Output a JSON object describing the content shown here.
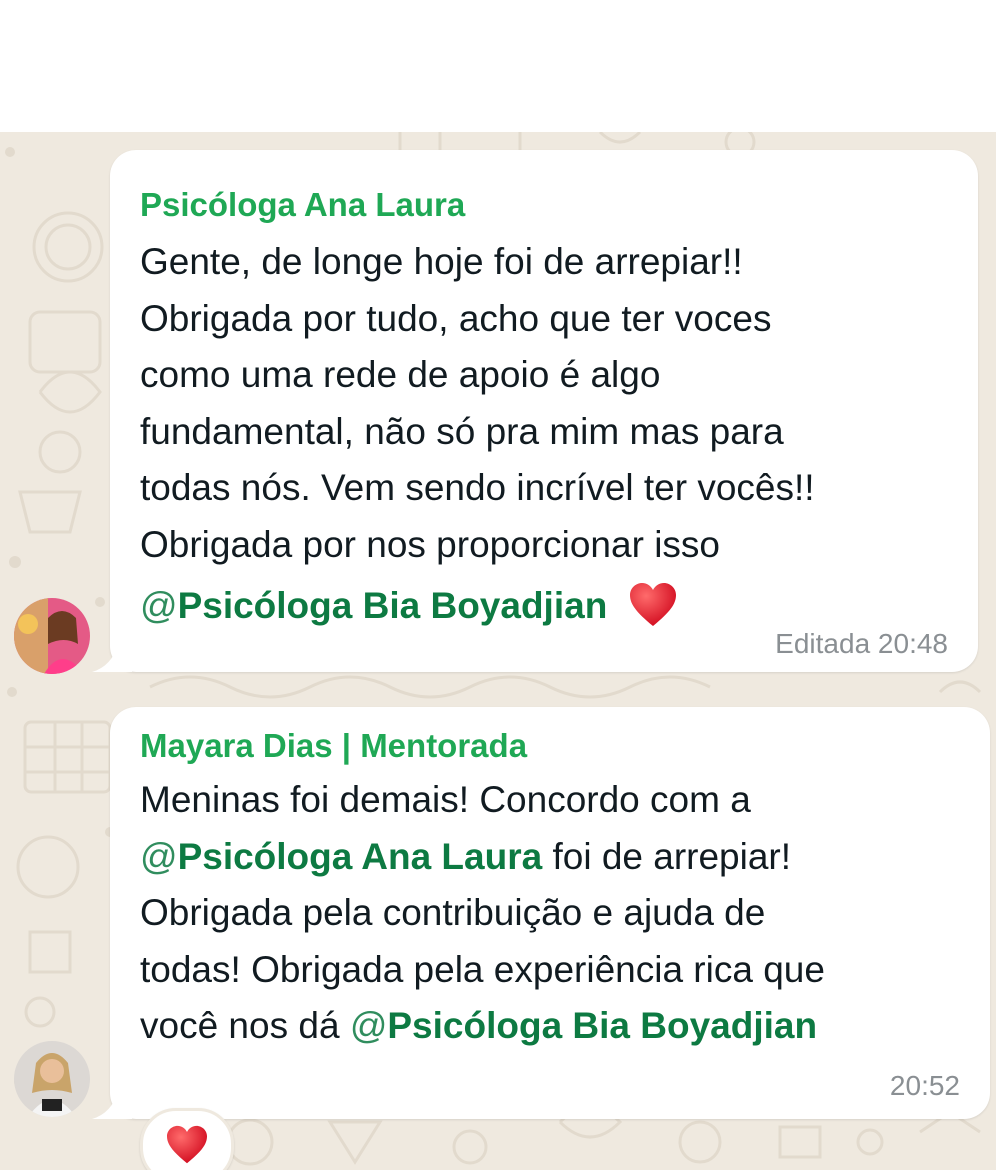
{
  "chat": {
    "messages": [
      {
        "sender": "Psicóloga Ana Laura",
        "lines": [
          "Gente, de longe hoje foi de arrepiar!!",
          "Obrigada por tudo, acho que ter voces",
          "como uma rede de apoio é algo",
          "fundamental, não só pra mim mas para",
          "todas nós. Vem sendo incrível ter vocês!!",
          "Obrigada por nos proporcionar isso"
        ],
        "mention_at": "@",
        "mention": "Psicóloga Bia Boyadjian",
        "edited_label": "Editada",
        "time": "20:48"
      },
      {
        "sender": "Mayara Dias | Mentorada",
        "line1": "Meninas foi demais! Concordo com a",
        "mention1_at": "@",
        "mention1": "Psicóloga Ana Laura",
        "line2_rest": " foi de arrepiar!",
        "line3": "Obrigada pela contribuição e ajuda de",
        "line4": "todas! Obrigada pela experiência rica que",
        "line5_prefix": "você nos dá ",
        "mention2_at": "@",
        "mention2": "Psicóloga Bia Boyadjian",
        "time": "20:52",
        "reaction": "heart"
      }
    ]
  },
  "icons": {
    "heart": "heart-emoji-icon",
    "avatar1": "avatar-ana-laura",
    "avatar2": "avatar-mayara-dias"
  },
  "colors": {
    "background": "#efe9df",
    "bubble": "#ffffff",
    "sender_name": "#1fa855",
    "mention": "#0d7a42",
    "timestamp": "#8a8f93",
    "text": "#111b21"
  }
}
